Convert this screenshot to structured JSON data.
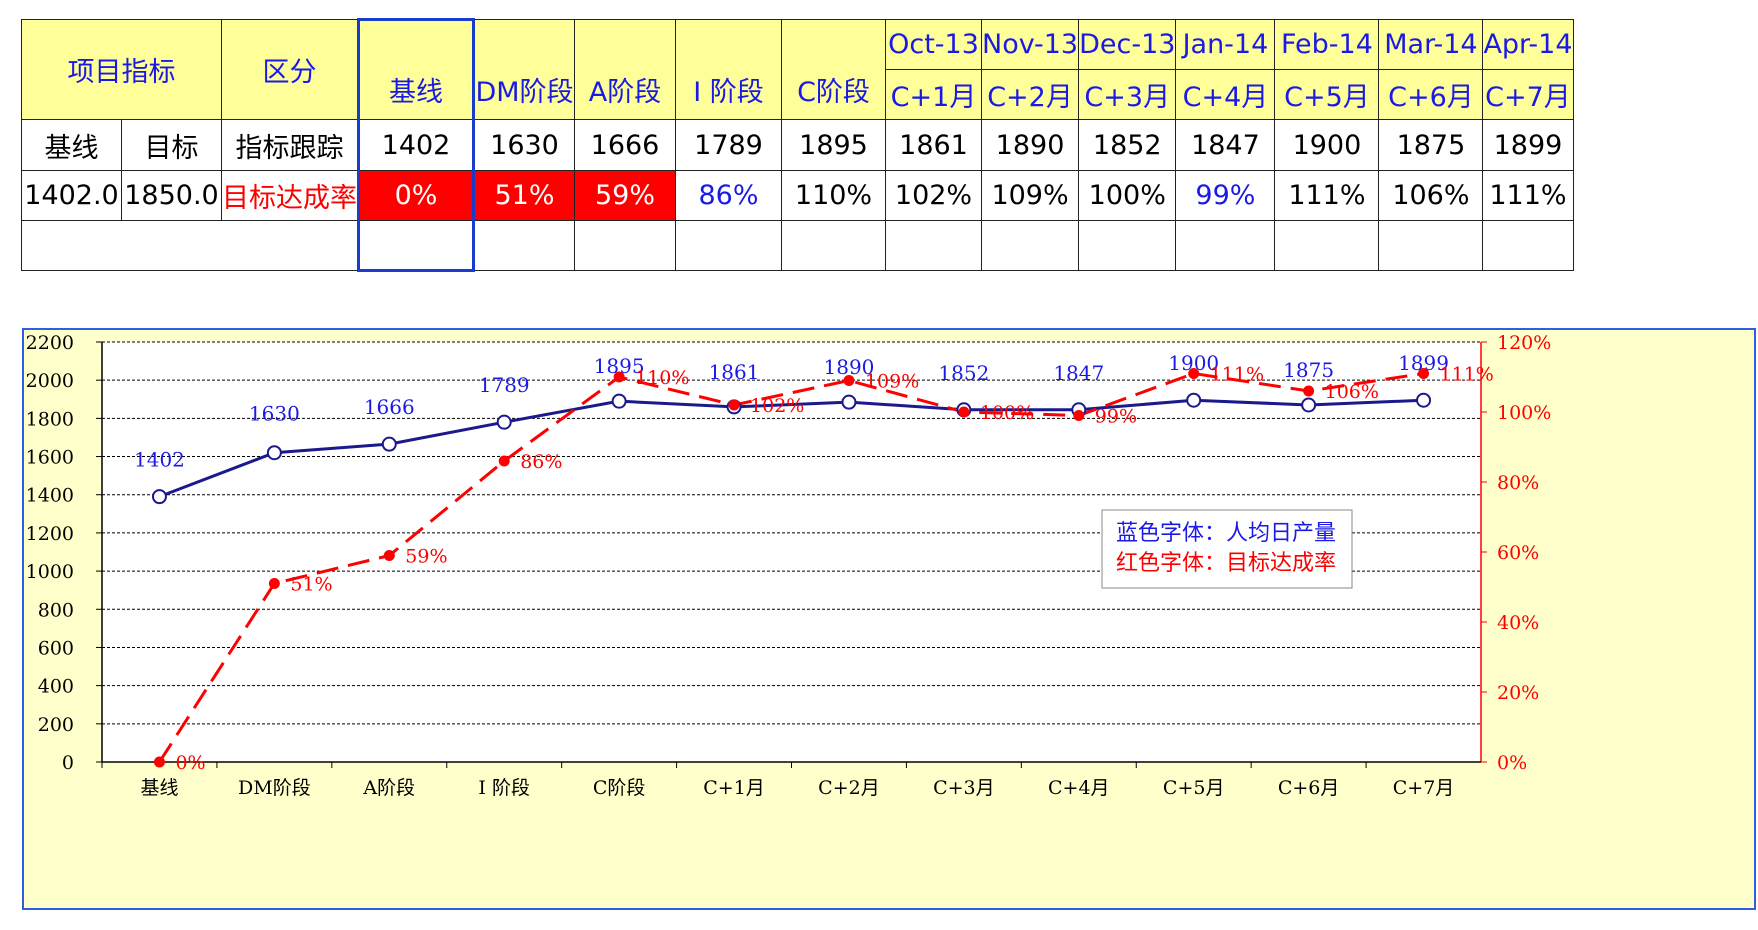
{
  "table": {
    "header": {
      "item_label": "项目指标",
      "section_label": "区分",
      "stages": [
        "基线",
        "DM阶段",
        "A阶段",
        "I 阶段",
        "C阶段"
      ],
      "months": [
        "Oct-13",
        "Nov-13",
        "Dec-13",
        "Jan-14",
        "Feb-14",
        "Mar-14",
        "Apr-14"
      ],
      "month_stages": [
        "C+1月",
        "C+2月",
        "C+3月",
        "C+4月",
        "C+5月",
        "C+6月",
        "C+7月"
      ]
    },
    "row1": {
      "label_a": "基线",
      "label_b": "目标",
      "label_c": "指标跟踪",
      "values": [
        "1402",
        "1630",
        "1666",
        "1789",
        "1895",
        "1861",
        "1890",
        "1852",
        "1847",
        "1900",
        "1875",
        "1899"
      ]
    },
    "row2": {
      "label_a": "1402.0",
      "label_b": "1850.0",
      "label_c": "目标达成率",
      "values": [
        "0%",
        "51%",
        "59%",
        "86%",
        "110%",
        "102%",
        "109%",
        "100%",
        "99%",
        "111%",
        "106%",
        "111%"
      ],
      "styles": [
        "red",
        "red",
        "red",
        "blue",
        "black",
        "black",
        "black",
        "black",
        "blue",
        "black",
        "black",
        "black"
      ]
    }
  },
  "chart_data": {
    "type": "line",
    "categories": [
      "基线",
      "DM阶段",
      "A阶段",
      "I 阶段",
      "C阶段",
      "C+1月",
      "C+2月",
      "C+3月",
      "C+4月",
      "C+5月",
      "C+6月",
      "C+7月"
    ],
    "series": [
      {
        "name": "蓝色字体：人均日产量",
        "axis": "left",
        "color": "#1a1a8c",
        "label_color": "#1a1ae6",
        "values": [
          1402,
          1630,
          1666,
          1789,
          1895,
          1861,
          1890,
          1852,
          1847,
          1900,
          1875,
          1899
        ],
        "plot_values": [
          1390,
          1620,
          1665,
          1780,
          1890,
          1860,
          1885,
          1845,
          1845,
          1895,
          1870,
          1895
        ],
        "labels": [
          "1402",
          "1630",
          "1666",
          "1789",
          "1895",
          "1861",
          "1890",
          "1852",
          "1847",
          "1900",
          "1875",
          "1899"
        ]
      },
      {
        "name": "红色字体：目标达成率",
        "axis": "right",
        "color": "#ff0000",
        "label_color": "#ff0000",
        "values": [
          0,
          51,
          59,
          86,
          110,
          102,
          109,
          100,
          99,
          111,
          106,
          111
        ],
        "labels": [
          "0%",
          "51%",
          "59%",
          "86%",
          "110%",
          "102%",
          "109%",
          "100%",
          "99%",
          "111%",
          "106%",
          "111%"
        ]
      }
    ],
    "y_left": {
      "min": 0,
      "max": 2200,
      "ticks": [
        "0",
        "200",
        "400",
        "600",
        "800",
        "1000",
        "1200",
        "1400",
        "1600",
        "1800",
        "2000",
        "2200"
      ]
    },
    "y_right": {
      "min": 0,
      "max": 120,
      "ticks": [
        "0%",
        "20%",
        "40%",
        "60%",
        "80%",
        "100%",
        "120%"
      ]
    },
    "grid": true,
    "legend_lines": [
      "蓝色字体：人均日产量",
      "红色字体：目标达成率"
    ],
    "legend_position": "right-middle"
  }
}
